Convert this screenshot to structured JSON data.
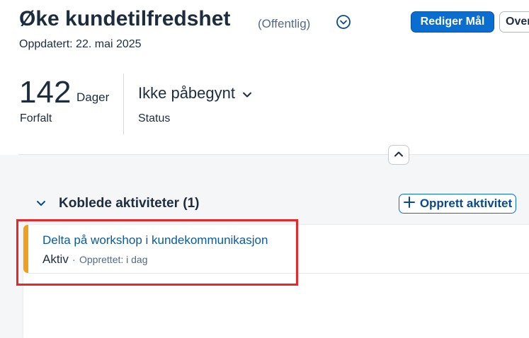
{
  "header": {
    "title": "Øke kundetilfredshet",
    "visibility": "(Offentlig)",
    "updated": "Oppdatert: 22. mai 2025",
    "edit_button": "Rediger Mål",
    "overflow_button": "Over"
  },
  "kpi": {
    "value": "142",
    "unit": "Dager",
    "label": "Forfalt"
  },
  "status": {
    "value": "Ikke påbegynt",
    "label": "Status"
  },
  "section": {
    "title": "Koblede aktiviteter (1)",
    "create_button": "Opprett aktivitet"
  },
  "activities": [
    {
      "title": "Delta på workshop i kundekommunikasjon",
      "status": "Aktiv",
      "separator": "·",
      "created": "Opprettet: i dag"
    }
  ],
  "colors": {
    "brand": "#0a6ed1",
    "accent_orange": "#f0a01e",
    "highlight_red": "#e8262b"
  },
  "icons": [
    "chevron-down-circle-icon",
    "chevron-down-icon",
    "chevron-up-icon",
    "plus-icon"
  ]
}
